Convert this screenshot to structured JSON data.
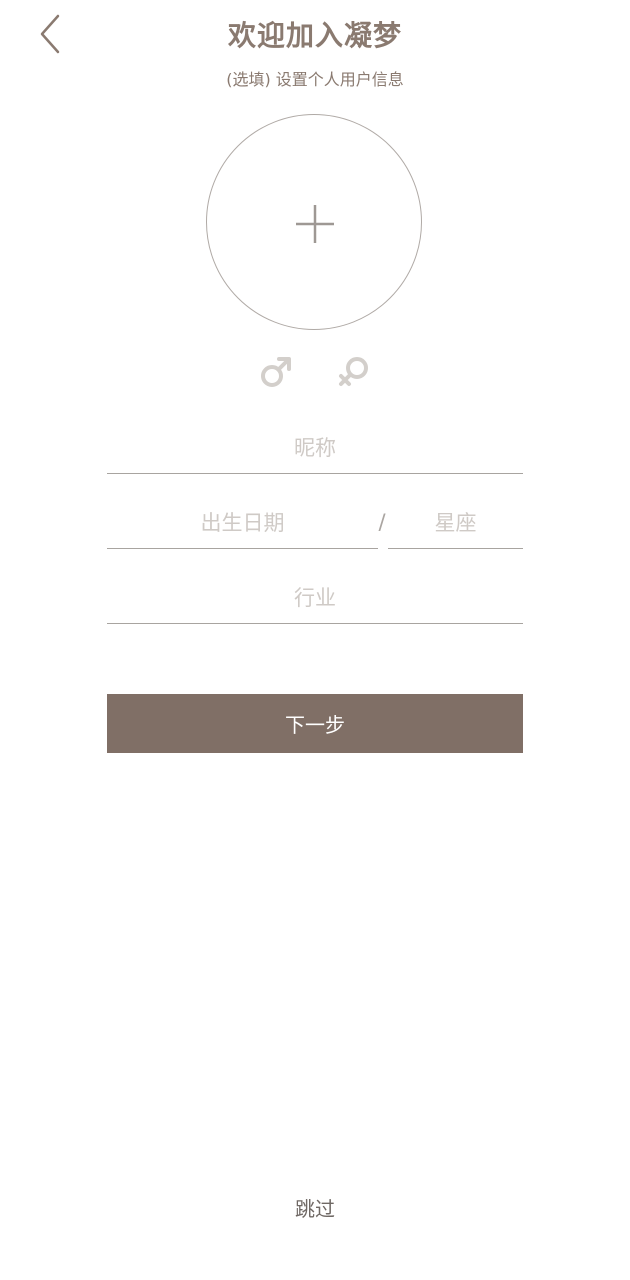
{
  "header": {
    "title": "欢迎加入凝梦",
    "subtitle": "(选填) 设置个人用户信息",
    "back_icon": "chevron-left-icon"
  },
  "avatar": {
    "icon": "plus-icon"
  },
  "gender": {
    "male_icon": "male-symbol-icon",
    "female_icon": "female-symbol-icon"
  },
  "form": {
    "nickname_placeholder": "昵称",
    "birthday_placeholder": "出生日期",
    "separator": "/",
    "constellation_placeholder": "星座",
    "industry_placeholder": "行业"
  },
  "actions": {
    "next_label": "下一步",
    "skip_label": "跳过"
  },
  "colors": {
    "accent": "#806f66",
    "title": "#8a7a70",
    "placeholder": "#cfcac6",
    "divider": "#a8a4a0"
  }
}
